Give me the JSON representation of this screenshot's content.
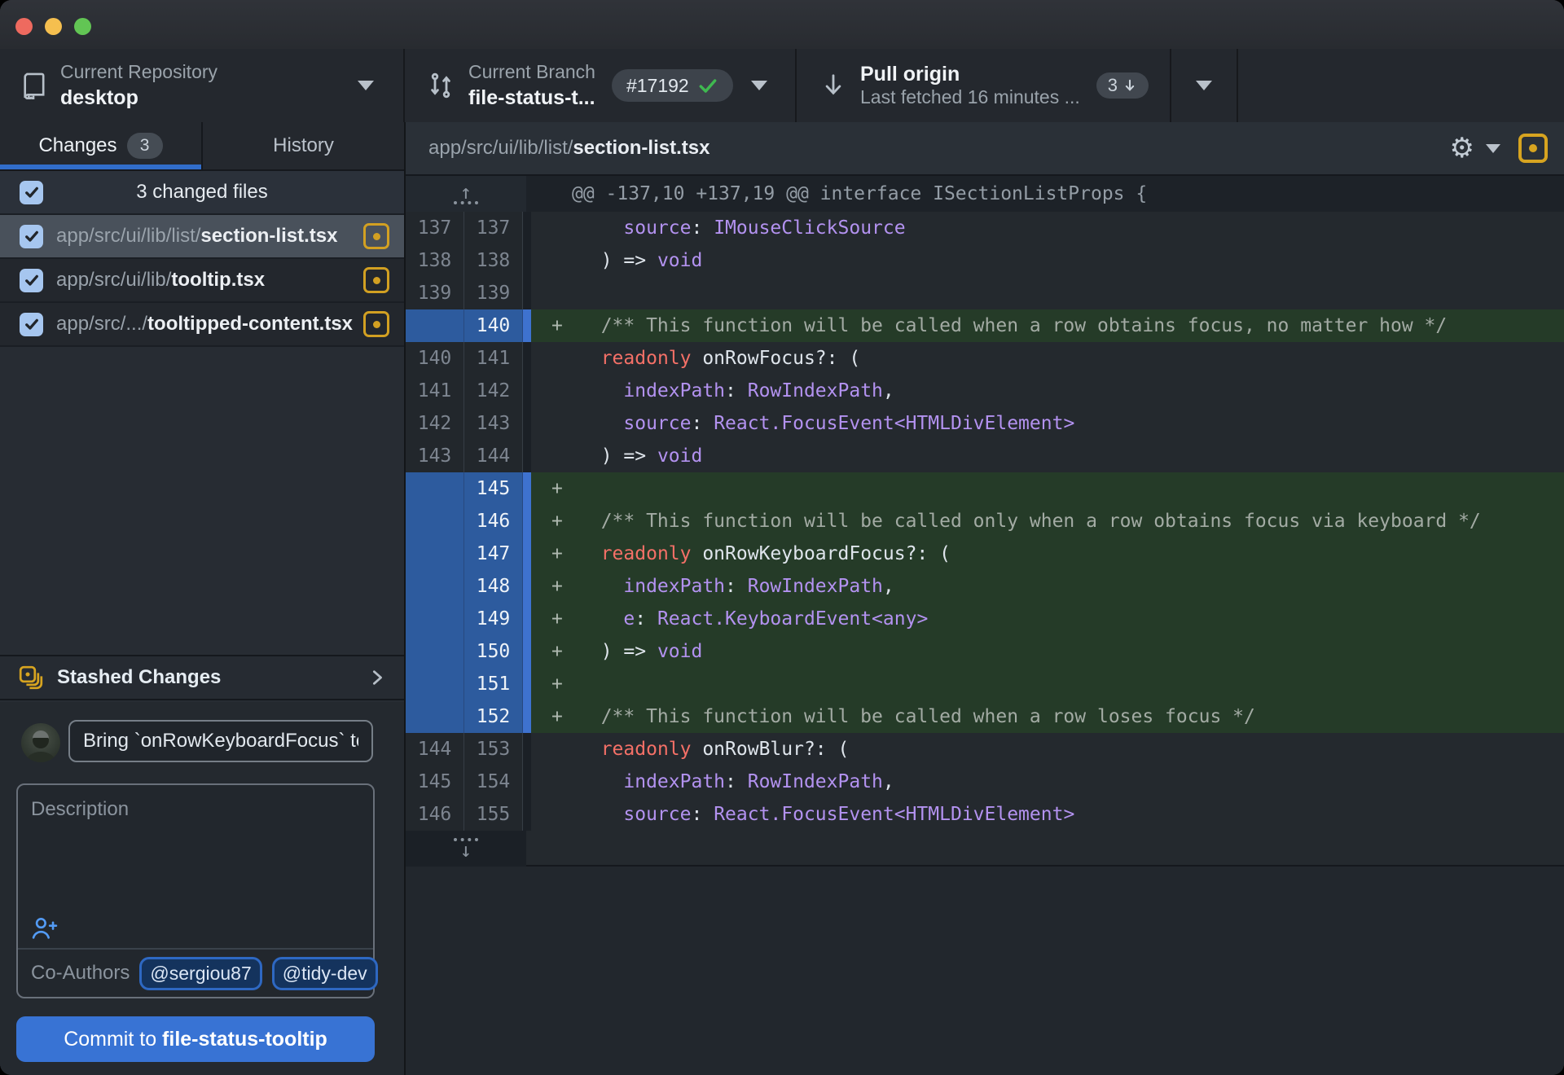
{
  "window": {
    "traffic_lights": [
      "close",
      "minimize",
      "zoom"
    ]
  },
  "toolbar": {
    "repo": {
      "label": "Current Repository",
      "value": "desktop"
    },
    "branch": {
      "label": "Current Branch",
      "value": "file-status-t...",
      "badge": "#17192"
    },
    "pull": {
      "title": "Pull origin",
      "subtitle": "Last fetched 16 minutes ...",
      "badge_count": "3"
    }
  },
  "sidebar": {
    "tabs": [
      {
        "label": "Changes",
        "badge": "3",
        "active": true
      },
      {
        "label": "History",
        "active": false
      }
    ],
    "header": {
      "label": "3 changed files",
      "checked": true
    },
    "files": [
      {
        "path": "app/src/ui/lib/list/",
        "name": "section-list.tsx",
        "checked": true,
        "status": "modified",
        "selected": true
      },
      {
        "path": "app/src/ui/lib/",
        "name": "tooltip.tsx",
        "checked": true,
        "status": "modified",
        "selected": false
      },
      {
        "path": "app/src/.../",
        "name": "tooltipped-content.tsx",
        "checked": true,
        "status": "modified",
        "selected": false
      }
    ],
    "stashed": {
      "label": "Stashed Changes"
    },
    "commit": {
      "summary": "Bring `onRowKeyboardFocus` to",
      "description_placeholder": "Description",
      "coauthors_label": "Co-Authors",
      "coauthors": [
        "@sergiou87",
        "@tidy-dev"
      ],
      "button_prefix": "Commit to ",
      "button_branch": "file-status-tooltip"
    }
  },
  "diff": {
    "file_path": "app/src/ui/lib/list/",
    "file_name": "section-list.tsx",
    "hunk_header": "@@ -137,10 +137,19 @@ interface ISectionListProps {",
    "lines": [
      {
        "old": "137",
        "new": "137",
        "type": "context",
        "tokens": [
          [
            "w",
            "    "
          ],
          [
            "p",
            "source"
          ],
          [
            "w",
            ": "
          ],
          [
            "p",
            "IMouseClickSource"
          ]
        ]
      },
      {
        "old": "138",
        "new": "138",
        "type": "context",
        "tokens": [
          [
            "w",
            "  ) => "
          ],
          [
            "p",
            "void"
          ]
        ]
      },
      {
        "old": "139",
        "new": "139",
        "type": "context",
        "tokens": []
      },
      {
        "old": "",
        "new": "140",
        "type": "added",
        "tokens": [
          [
            "c",
            "  /** This function will be called when a row obtains focus, no matter how */"
          ]
        ]
      },
      {
        "old": "140",
        "new": "141",
        "type": "context",
        "tokens": [
          [
            "w",
            "  "
          ],
          [
            "r",
            "readonly"
          ],
          [
            "w",
            " onRowFocus?: ("
          ]
        ]
      },
      {
        "old": "141",
        "new": "142",
        "type": "context",
        "tokens": [
          [
            "w",
            "    "
          ],
          [
            "p",
            "indexPath"
          ],
          [
            "w",
            ": "
          ],
          [
            "p",
            "RowIndexPath"
          ],
          [
            "w",
            ","
          ]
        ]
      },
      {
        "old": "142",
        "new": "143",
        "type": "context",
        "tokens": [
          [
            "w",
            "    "
          ],
          [
            "p",
            "source"
          ],
          [
            "w",
            ": "
          ],
          [
            "p",
            "React.FocusEvent<HTMLDivElement>"
          ]
        ]
      },
      {
        "old": "143",
        "new": "144",
        "type": "context",
        "tokens": [
          [
            "w",
            "  ) => "
          ],
          [
            "p",
            "void"
          ]
        ]
      },
      {
        "old": "",
        "new": "145",
        "type": "added",
        "tokens": []
      },
      {
        "old": "",
        "new": "146",
        "type": "added",
        "tokens": [
          [
            "c",
            "  /** This function will be called only when a row obtains focus via keyboard */"
          ]
        ]
      },
      {
        "old": "",
        "new": "147",
        "type": "added",
        "tokens": [
          [
            "w",
            "  "
          ],
          [
            "r",
            "readonly"
          ],
          [
            "w",
            " onRowKeyboardFocus?: ("
          ]
        ]
      },
      {
        "old": "",
        "new": "148",
        "type": "added",
        "tokens": [
          [
            "w",
            "    "
          ],
          [
            "p",
            "indexPath"
          ],
          [
            "w",
            ": "
          ],
          [
            "p",
            "RowIndexPath"
          ],
          [
            "w",
            ","
          ]
        ]
      },
      {
        "old": "",
        "new": "149",
        "type": "added",
        "tokens": [
          [
            "w",
            "    "
          ],
          [
            "p",
            "e"
          ],
          [
            "w",
            ": "
          ],
          [
            "p",
            "React.KeyboardEvent<any>"
          ]
        ]
      },
      {
        "old": "",
        "new": "150",
        "type": "added",
        "tokens": [
          [
            "w",
            "  ) => "
          ],
          [
            "p",
            "void"
          ]
        ]
      },
      {
        "old": "",
        "new": "151",
        "type": "added",
        "tokens": []
      },
      {
        "old": "",
        "new": "152",
        "type": "added",
        "tokens": [
          [
            "c",
            "  /** This function will be called when a row loses focus */"
          ]
        ]
      },
      {
        "old": "144",
        "new": "153",
        "type": "context",
        "tokens": [
          [
            "w",
            "  "
          ],
          [
            "r",
            "readonly"
          ],
          [
            "w",
            " onRowBlur?: ("
          ]
        ]
      },
      {
        "old": "145",
        "new": "154",
        "type": "context",
        "tokens": [
          [
            "w",
            "    "
          ],
          [
            "p",
            "indexPath"
          ],
          [
            "w",
            ": "
          ],
          [
            "p",
            "RowIndexPath"
          ],
          [
            "w",
            ","
          ]
        ]
      },
      {
        "old": "146",
        "new": "155",
        "type": "context",
        "tokens": [
          [
            "w",
            "    "
          ],
          [
            "p",
            "source"
          ],
          [
            "w",
            ": "
          ],
          [
            "p",
            "React.FocusEvent<HTMLDivElement>"
          ]
        ]
      }
    ]
  },
  "colors": {
    "accent_blue": "#3873d4",
    "tab_underline_blue": "#316dca",
    "added_line_bg": "#253b28",
    "added_gutter_blue": "#2d5b9e",
    "modified_status_yellow": "#d2a022",
    "syntax_keyword_red": "#f47067",
    "syntax_type_purple": "#b392f0",
    "syntax_comment_gray": "#a3aba4",
    "check_green": "#3fb950",
    "traffic_red": "#ee6a5f",
    "traffic_yellow": "#f5bf4f",
    "traffic_green": "#62c554"
  }
}
